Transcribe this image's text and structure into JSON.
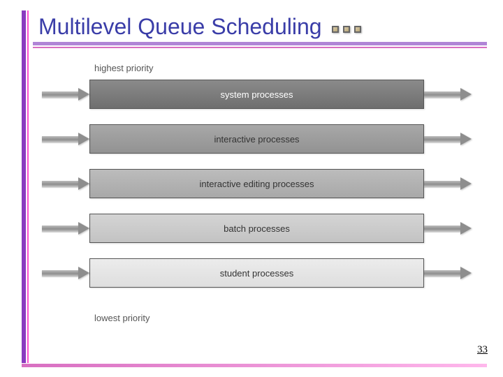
{
  "title": "Multilevel Queue Scheduling",
  "labels": {
    "highest": "highest priority",
    "lowest": "lowest priority"
  },
  "queues": [
    {
      "name": "system processes"
    },
    {
      "name": "interactive processes"
    },
    {
      "name": "interactive editing processes"
    },
    {
      "name": "batch processes"
    },
    {
      "name": "student processes"
    }
  ],
  "page_number": "33"
}
